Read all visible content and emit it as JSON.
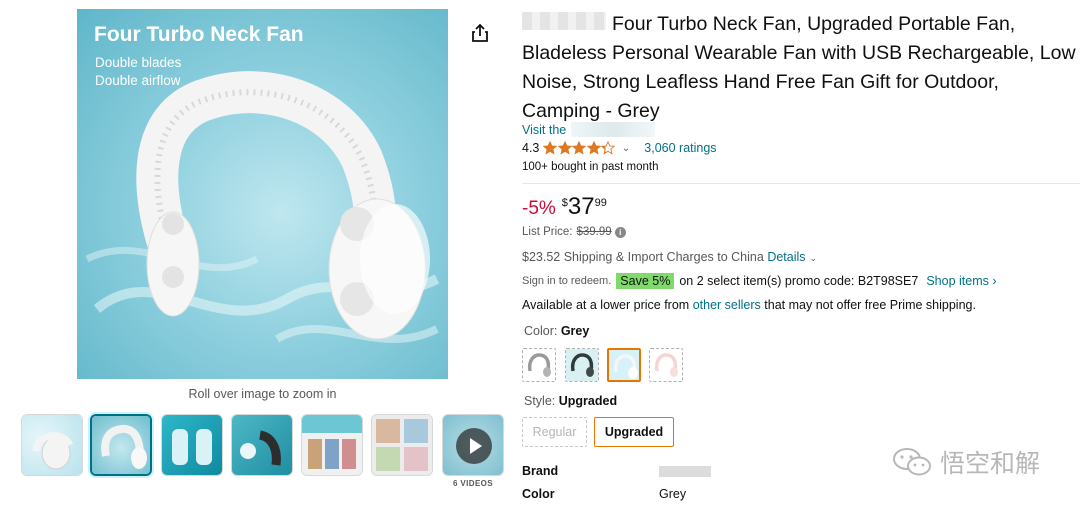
{
  "gallery": {
    "main_image": {
      "headline": "Four Turbo Neck Fan",
      "line1": "Double blades",
      "line2": "Double airflow",
      "icon": "neck-fan-product-image"
    },
    "zoom_hint": "Roll over image to zoom in",
    "thumbnails": [
      {
        "icon": "neck-fan-side-view",
        "selected": false
      },
      {
        "icon": "neck-fan-thumbnail",
        "selected": true
      },
      {
        "icon": "dual-airflow-thumbnail",
        "selected": false
      },
      {
        "icon": "fan-inlet-thumbnail",
        "selected": false
      },
      {
        "icon": "speed-modes-thumbnail",
        "selected": false
      },
      {
        "icon": "lifestyle-thumbnail",
        "selected": false
      },
      {
        "icon": "play-video-icon",
        "selected": false
      }
    ],
    "videos_label": "6 VIDEOS",
    "share_icon": "share-icon"
  },
  "product": {
    "title": "Four Turbo Neck Fan, Upgraded Portable Fan, Bladeless Personal Wearable Fan with USB Rechargeable, Low Noise, Strong Leafless Hand Free Fan Gift for Outdoor, Camping - Grey",
    "visit_store": "Visit the",
    "rating_value": "4.3",
    "rating_stars": 4.3,
    "ratings_count": "3,060 ratings",
    "bought_text": "100+ bought in past month"
  },
  "price": {
    "discount": "-5%",
    "currency": "$",
    "whole": "37",
    "fraction": "99",
    "list_price_label": "List Price:",
    "list_price": "$39.99",
    "shipping_text": "$23.52 Shipping & Import Charges to China",
    "shipping_details": "Details"
  },
  "promo": {
    "signin": "Sign in to redeem.",
    "badge": "Save 5%",
    "text": "on 2 select item(s) promo code: B2T98SE7",
    "shop_link": "Shop items ›"
  },
  "offers": {
    "prefix": "Available at a lower price from",
    "link": "other sellers",
    "suffix": "that may not offer free Prime shipping."
  },
  "variations": {
    "color_label": "Color:",
    "color_value": "Grey",
    "swatches": [
      "grey-fan-swatch",
      "black-fan-swatch",
      "blue-fan-swatch",
      "pink-fan-swatch"
    ],
    "style_label": "Style:",
    "style_value": "Upgraded",
    "style_options": [
      "Regular",
      "Upgraded"
    ]
  },
  "specs": {
    "brand_label": "Brand",
    "color_label": "Color",
    "color_value": "Grey"
  },
  "watermark": {
    "text": "悟空和解",
    "icon": "wechat-icon"
  },
  "colors": {
    "link": "#007185",
    "deal_red": "#cc0c39",
    "selected_orange": "#e77600",
    "star_orange": "#de7921",
    "badge_green": "#7fda69"
  }
}
